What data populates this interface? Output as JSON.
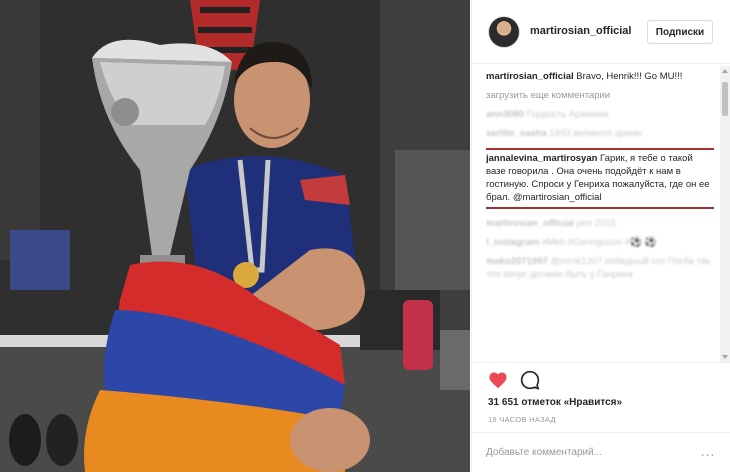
{
  "post": {
    "username": "martirosian_official",
    "subscribe_label": "Подписки",
    "photo_alt": "",
    "colors": {
      "highlight_border": "#a3312f",
      "like_red": "#ed4956"
    }
  },
  "caption": {
    "username": "martirosian_official",
    "text": " Bravo, Henrik!!! Go MU!!!"
  },
  "load_more_label": "загрузить еще комментарии",
  "comments_blurred_top": [
    {
      "username": "ann3080",
      "text": " Гордость Армении"
    },
    {
      "username": "serlito_sasha",
      "text": " 1993 великого армян"
    }
  ],
  "highlighted_comment": {
    "username": "jannalevina_martirosyan",
    "text": " Гарик, я тебе о такой вазе говорила . Она очень подойдёт к нам в гостиную. Спроси у Генриха пожалуйста, где он ее брал. @martirosian_official"
  },
  "comments_blurred_bottom": [
    {
      "username": "martirosian_official",
      "text": " pen 2015"
    },
    {
      "username": "l_instagram",
      "text": " #Mkh #Genrigsoon #⚽ ⚽"
    },
    {
      "username": "mako2071997",
      "text": " @mrrik1207 победный гол Погба так что конус должен быть у Ганриха"
    }
  ],
  "actions": {
    "like_icon": "heart-icon",
    "comment_icon": "comment-bubble-icon",
    "likes_text": "31 651 отметок «Нравится»",
    "time_text": "19 ЧАСОВ НАЗАД"
  },
  "add_comment": {
    "placeholder": "Добавьте комментарий...",
    "more_label": "..."
  }
}
